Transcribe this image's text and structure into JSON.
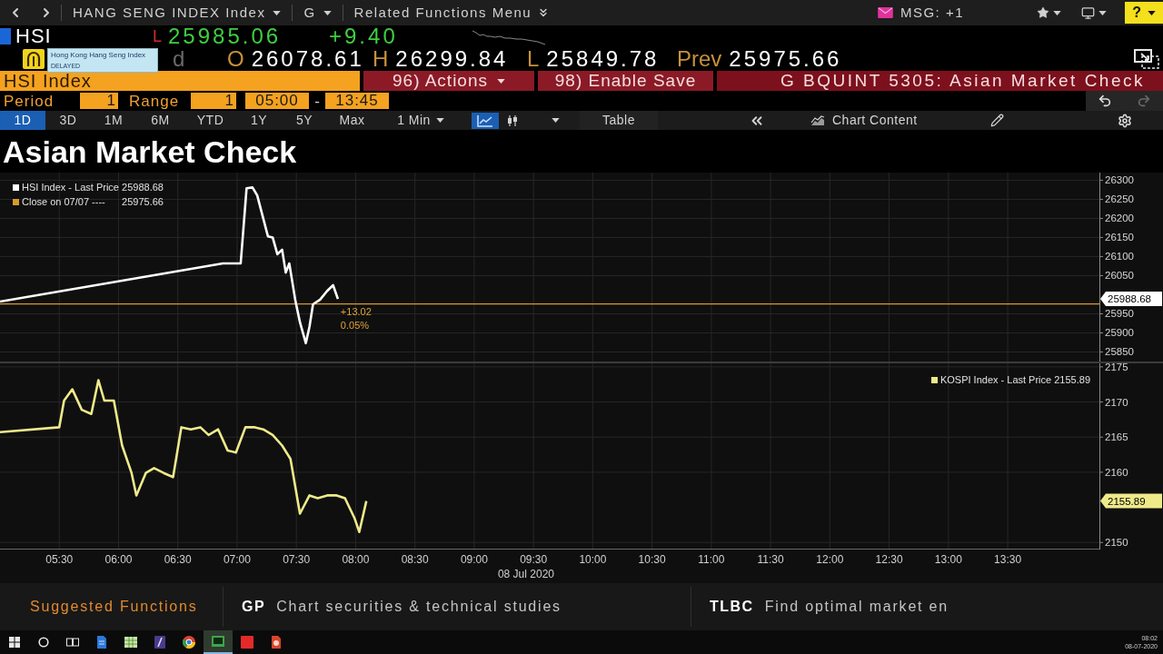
{
  "top_bar": {
    "security": "HANG SENG INDEX Index",
    "function": "G",
    "related": "Related Functions Menu",
    "messages": "MSG: +1",
    "help": "?"
  },
  "quote": {
    "ticker": "HSI",
    "tick_flag": "L",
    "last": "25985.06",
    "change": "+9.40",
    "prefix": "d",
    "fields": [
      {
        "label": "O",
        "value": "26078.61"
      },
      {
        "label": "H",
        "value": "26299.84"
      },
      {
        "label": "L",
        "value": "25849.78"
      },
      {
        "label": "Prev",
        "value": "25975.66"
      }
    ]
  },
  "tooltip": {
    "title": "Hong Kong Hang Seng Index",
    "status": "DELAYED"
  },
  "action_bar": {
    "security": "HSI Index",
    "buttons": [
      {
        "label": "96) Actions",
        "kind": "menu"
      },
      {
        "label": "98) Enable Save",
        "kind": "plain"
      }
    ],
    "title": "G BQUINT 5305: Asian Market Check"
  },
  "period_row": {
    "period_label": "Period",
    "period": "1",
    "range_label": "Range",
    "range": "1",
    "start": "05:00",
    "separator": "-",
    "end": "13:45"
  },
  "chart_toolbar": {
    "ranges": [
      {
        "label": "1D",
        "selected": true
      },
      {
        "label": "3D",
        "selected": false
      },
      {
        "label": "1M",
        "selected": false
      },
      {
        "label": "6M",
        "selected": false
      },
      {
        "label": "YTD",
        "selected": false
      },
      {
        "label": "1Y",
        "selected": false
      },
      {
        "label": "5Y",
        "selected": false
      },
      {
        "label": "Max",
        "selected": false
      }
    ],
    "interval": "1 Min",
    "chart_types": [
      {
        "kind": "line",
        "selected": true
      },
      {
        "kind": "bar",
        "selected": false
      }
    ],
    "table": "Table",
    "chart_content": "Chart Content"
  },
  "title": "Asian Market Check",
  "chart_area": {
    "chart_data": [
      {
        "type": "line",
        "legend": "top-left",
        "grid": true,
        "tick_labels": "y",
        "xlim": [
          5,
          14.81
        ],
        "ylim": [
          25825,
          26320
        ],
        "xticks": [
          5.5,
          6,
          6.5,
          7,
          7.5,
          8,
          8.5,
          9,
          9.5,
          10,
          10.5,
          11,
          11.5,
          12,
          12.5,
          13,
          13.5
        ],
        "yticks": [
          25850,
          25900,
          25950,
          26050,
          26100,
          26150,
          26200,
          26250,
          26300
        ],
        "x": [
          5.0,
          6.88,
          7.03,
          7.08,
          7.13,
          7.17,
          7.22,
          7.26,
          7.3,
          7.34,
          7.38,
          7.41,
          7.44,
          7.49,
          7.53,
          7.58,
          7.61,
          7.64,
          7.7,
          7.76,
          7.81,
          7.85
        ],
        "series": [
          {
            "name": "HSI Index - Last Price 25988.68",
            "color": "#ffffff",
            "values": [
              25982,
              26082,
              26082,
              26279,
              26281,
              26260,
              26200,
              26153,
              26150,
              26106,
              26118,
              26058,
              26082,
              25987,
              25928,
              25873,
              25916,
              25975,
              25987,
              26010,
              26025,
              25989
            ]
          }
        ],
        "ref_lines": [
          {
            "axis": "y",
            "value": 25975.66,
            "label": "Close on 07/07 ----      25975.66",
            "color": "#d89a2b",
            "line_style": "solid"
          }
        ],
        "annotations": [
          "+13.02",
          "0.05%"
        ]
      },
      {
        "type": "line",
        "legend": "top-right",
        "grid": true,
        "xlim": [
          5,
          14.81
        ],
        "ylim": [
          2149,
          2175.5
        ],
        "xticks": [
          {
            "value": 5.5,
            "label": "05:30"
          },
          {
            "value": 6,
            "label": "06:00"
          },
          {
            "value": 6.5,
            "label": "06:30"
          },
          {
            "value": 7,
            "label": "07:00"
          },
          {
            "value": 7.5,
            "label": "07:30"
          },
          {
            "value": 8,
            "label": "08:00"
          },
          {
            "value": 8.5,
            "label": "08:30"
          },
          {
            "value": 9,
            "label": "09:00"
          },
          {
            "value": 9.5,
            "label": "09:30"
          },
          {
            "value": 10,
            "label": "10:00"
          },
          {
            "value": 10.5,
            "label": "10:30"
          },
          {
            "value": 11,
            "label": "11:00"
          },
          {
            "value": 11.5,
            "label": "11:30"
          },
          {
            "value": 12,
            "label": "12:00"
          },
          {
            "value": 12.5,
            "label": "12:30"
          },
          {
            "value": 13,
            "label": "13:00"
          },
          {
            "value": 13.5,
            "label": "13:30"
          }
        ],
        "yticks": [
          2150,
          2160,
          2165,
          2170,
          2175
        ],
        "xlabel": "08 Jul 2020",
        "x": [
          5.0,
          5.5,
          5.54,
          5.61,
          5.69,
          5.77,
          5.83,
          5.88,
          5.96,
          6.03,
          6.11,
          6.15,
          6.23,
          6.3,
          6.38,
          6.46,
          6.53,
          6.61,
          6.69,
          6.76,
          6.84,
          6.92,
          6.99,
          7.07,
          7.15,
          7.22,
          7.3,
          7.38,
          7.45,
          7.53,
          7.61,
          7.68,
          7.76,
          7.84,
          7.91,
          7.99,
          8.03,
          8.09
        ],
        "series": [
          {
            "name": "KOSPI Index - Last Price 2155.89",
            "color": "#eeea8a",
            "values": [
              2165.7,
              2166.4,
              2170.2,
              2171.8,
              2168.9,
              2168.3,
              2173.1,
              2170.2,
              2170.2,
              2163.8,
              2159.9,
              2156.7,
              2159.9,
              2160.6,
              2159.9,
              2159.3,
              2166.4,
              2166.1,
              2166.4,
              2165.3,
              2166.1,
              2163.1,
              2162.8,
              2166.4,
              2166.4,
              2166.1,
              2165.3,
              2163.8,
              2161.9,
              2154.1,
              2156.7,
              2156.3,
              2156.7,
              2156.7,
              2156.3,
              2153.5,
              2151.5,
              2155.9
            ]
          }
        ]
      }
    ],
    "price_tags": [
      "25988.68",
      "2155.89"
    ]
  },
  "suggested_functions": {
    "heading": "Suggested Functions",
    "items": [
      {
        "code": "GP",
        "description": "Chart securities & technical studies"
      },
      {
        "code": "TLBC",
        "description": "Find optimal market en"
      }
    ]
  },
  "taskbar": {
    "apps": [
      {
        "kind": "start",
        "selected": false
      },
      {
        "kind": "search",
        "selected": false
      },
      {
        "kind": "task-view",
        "selected": false
      },
      {
        "kind": "document",
        "selected": false
      },
      {
        "kind": "spreadsheet",
        "selected": false
      },
      {
        "kind": "app",
        "selected": false
      },
      {
        "kind": "browser",
        "selected": false
      },
      {
        "kind": "terminal",
        "selected": true
      },
      {
        "kind": "media",
        "selected": false
      },
      {
        "kind": "presentation",
        "selected": false
      }
    ],
    "clock_time": "08:02",
    "clock_date": "08-07-2020"
  }
}
